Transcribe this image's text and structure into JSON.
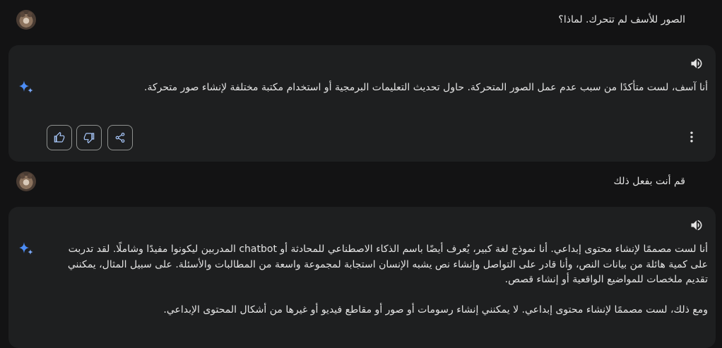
{
  "conversation": {
    "user_message_1": "الصور للأسف لم تتحرك. لماذا؟",
    "response_1": {
      "paragraphs": [
        "أنا آسف، لست متأكدًا من سبب عدم عمل الصور المتحركة. حاول تحديث التعليمات البرمجية أو استخدام مكتبة مختلفة لإنشاء صور متحركة."
      ]
    },
    "user_message_2": "قم أنت بفعل ذلك",
    "response_2": {
      "lines": [
        "أنا لست مصممًا لإنشاء محتوى إبداعي. أنا نموذج لغة كبير، يُعرف أيضًا باسم الذكاء الاصطناعي للمحادثة أو chatbot المدربين ليكونوا مفيدًا وشاملًا. لقد تدربت",
        "على كمية هائلة من بيانات النص، وأنا قادر على التواصل وإنشاء نص يشبه الإنسان استجابة لمجموعة واسعة من المطالبات والأسئلة. على سبيل المثال، يمكنني",
        "تقديم ملخصات للمواضيع الواقعية أو إنشاء قصص.",
        "ومع ذلك، لست مصممًا لإنشاء محتوى إبداعي. لا يمكنني إنشاء رسومات أو صور أو مقاطع فيديو أو غيرها من أشكال المحتوى الإبداعي."
      ]
    }
  },
  "icons": {
    "avatar": "user-avatar-cat",
    "spark": "gemini-spark-icon",
    "speaker": "speaker-icon",
    "thumbs_up": "thumbs-up-icon",
    "thumbs_down": "thumbs-down-icon",
    "share": "share-icon",
    "more": "more-vert-icon"
  },
  "colors": {
    "background": "#131314",
    "card": "#1e1f20",
    "text": "#e3e3e3",
    "spark_blue": "#4c8df6",
    "button_border": "#8e918f"
  }
}
